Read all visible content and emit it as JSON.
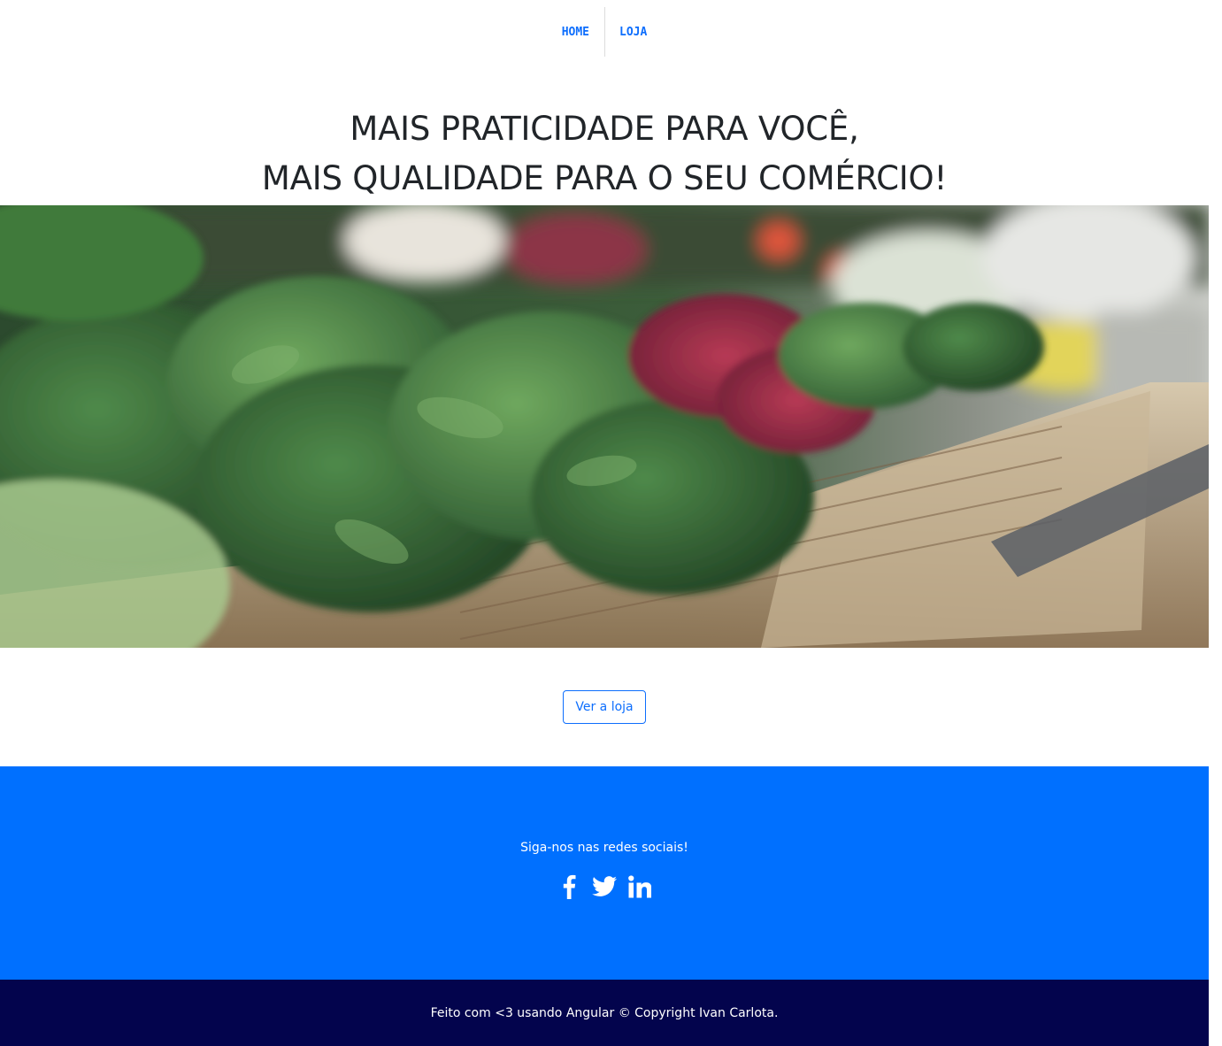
{
  "nav": {
    "items": [
      {
        "label": "HOME"
      },
      {
        "label": "LOJA"
      }
    ]
  },
  "hero": {
    "headline_line1": "MAIS PRATICIDADE PARA VOCÊ,",
    "headline_line2": "MAIS QUALIDADE PARA O SEU COMÉRCIO!",
    "image_subject": "vegetables on market shelves"
  },
  "cta": {
    "label": "Ver a loja"
  },
  "social": {
    "heading": "Siga-nos nas redes sociais!",
    "icons": [
      "facebook-icon",
      "twitter-icon",
      "linkedin-icon"
    ],
    "background": "#0070ff"
  },
  "footer": {
    "text": "Feito com <3 usando Angular © Copyright Ivan Carlota.",
    "background": "#03044d"
  },
  "colors": {
    "accent": "#0d6efd"
  }
}
